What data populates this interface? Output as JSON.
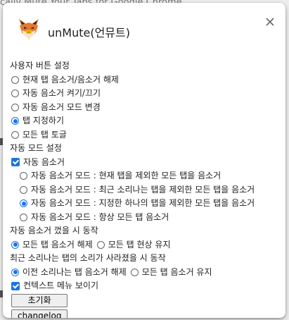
{
  "background": {
    "partial_text": "cally Mute Your Tabs for Google Chrome"
  },
  "dialog": {
    "title": "unMute(언뮤트)",
    "logo": "fox-icon",
    "close": "close-icon"
  },
  "settings": {
    "user_button": {
      "heading": "사용자 버튼 설정",
      "options": [
        {
          "label": "현재 탭 음소거/음소거 해제",
          "checked": false
        },
        {
          "label": "자동 음소거 켜기/끄기",
          "checked": false
        },
        {
          "label": "자동 음소거 모드 변경",
          "checked": false
        },
        {
          "label": "탭 지정하기",
          "checked": true
        },
        {
          "label": "모든 탭 토글",
          "checked": false
        }
      ]
    },
    "auto_mode": {
      "heading": "자동 모드 설정",
      "auto_mute_label": "자동 음소거",
      "auto_mute_checked": true,
      "options": [
        {
          "label": "자동 음소거 모드 : 현재 탭을 제외한 모든 탭을 음소거",
          "checked": false
        },
        {
          "label": "자동 음소거 모드 : 최근 소리나는 탭을 제외한 모든 탭을 음소거",
          "checked": false
        },
        {
          "label": "자동 음소거 모드 : 지정한 하나의 탭을 제외한 모든 탭을 음소거",
          "checked": true
        },
        {
          "label": "자동 음소거 모드 : 항상 모든 탭 음소거",
          "checked": false
        }
      ]
    },
    "when_off": {
      "heading": "자동 음소거 껐을 시 동작",
      "options": [
        {
          "label": "모든 탭 음소거 해제",
          "checked": true
        },
        {
          "label": "모든 탭 현상 유지",
          "checked": false
        }
      ]
    },
    "when_sound_gone": {
      "heading": "최근 소리나는 탭의 소리가 사라졌을 시 동작",
      "options": [
        {
          "label": "이전 소리나는 탭 음소거 해제",
          "checked": true
        },
        {
          "label": "모든 탭 음소거 유지",
          "checked": false
        }
      ]
    },
    "context_menu": {
      "label": "컨텍스트 메뉴 보이기",
      "checked": true
    }
  },
  "buttons": {
    "reset": "초기화",
    "changelog": "changelog"
  },
  "colors": {
    "accent": "#1a73e8",
    "fox_orange": "#e8772e"
  }
}
